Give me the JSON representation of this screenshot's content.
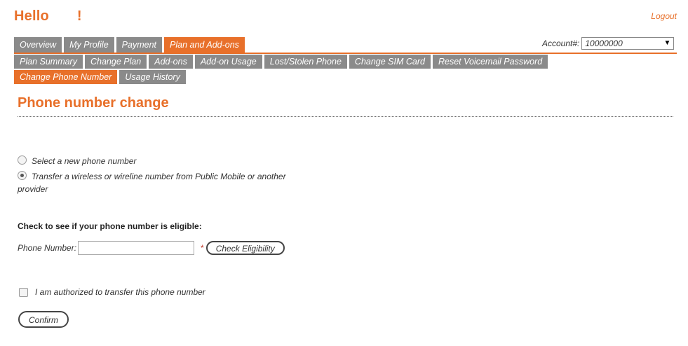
{
  "header": {
    "greeting": "Hello",
    "greeting_suffix": "!",
    "logout_label": "Logout"
  },
  "primary_tabs": [
    {
      "label": "Overview",
      "active": false
    },
    {
      "label": "My Profile",
      "active": false
    },
    {
      "label": "Payment",
      "active": false
    },
    {
      "label": "Plan and Add-ons",
      "active": true
    }
  ],
  "account": {
    "label": "Account#:",
    "selected": "10000000"
  },
  "secondary_tabs": [
    {
      "label": "Plan Summary",
      "active": false
    },
    {
      "label": "Change Plan",
      "active": false
    },
    {
      "label": "Add-ons",
      "active": false
    },
    {
      "label": "Add-on Usage",
      "active": false
    },
    {
      "label": "Lost/Stolen Phone",
      "active": false
    },
    {
      "label": "Change SIM Card",
      "active": false
    },
    {
      "label": "Reset Voicemail Password",
      "active": false
    },
    {
      "label": "Change Phone Number",
      "active": true
    },
    {
      "label": "Usage History",
      "active": false
    }
  ],
  "main": {
    "title": "Phone number change",
    "options": [
      {
        "label": "Select a new phone number",
        "checked": false
      },
      {
        "label": "Transfer a wireless or wireline number from Public Mobile or another",
        "label_line2": "provider",
        "checked": true
      }
    ],
    "eligibility_heading": "Check to see if your phone number is eligible:",
    "phone_label": "Phone Number:",
    "phone_value": "",
    "required_mark": "*",
    "check_button": "Check Eligibility",
    "authorize_label": "I am authorized to transfer this phone number",
    "confirm_button": "Confirm"
  },
  "colors": {
    "accent": "#e8702a",
    "tab_gray": "#8a8a8a"
  }
}
